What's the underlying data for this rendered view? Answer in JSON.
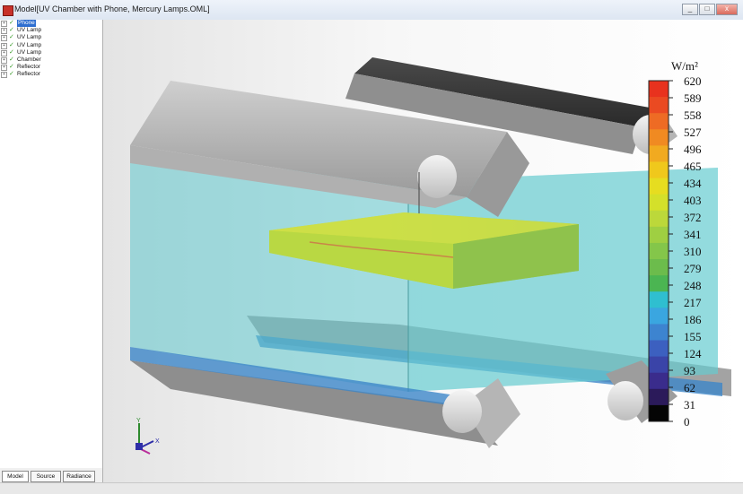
{
  "window": {
    "title": "Model[UV Chamber with Phone, Mercury Lamps.OML]",
    "controls": [
      "_",
      "□",
      "x"
    ]
  },
  "tree": {
    "items": [
      {
        "label": "Phone",
        "selected": true
      },
      {
        "label": "UV Lamp",
        "selected": false
      },
      {
        "label": "UV Lamp",
        "selected": false
      },
      {
        "label": "UV Lamp",
        "selected": false
      },
      {
        "label": "UV Lamp",
        "selected": false
      },
      {
        "label": "Chamber",
        "selected": false
      },
      {
        "label": "Reflector",
        "selected": false
      },
      {
        "label": "Reflector",
        "selected": false
      }
    ]
  },
  "tabs": [
    {
      "label": "Model",
      "active": true
    },
    {
      "label": "Source",
      "active": false
    },
    {
      "label": "Radiance",
      "active": false
    }
  ],
  "legend": {
    "unit": "W/m²",
    "ticks": [
      "620",
      "589",
      "558",
      "527",
      "496",
      "465",
      "434",
      "403",
      "372",
      "341",
      "310",
      "279",
      "248",
      "217",
      "186",
      "155",
      "124",
      "93",
      "62",
      "31",
      "0"
    ],
    "colors": [
      "#e8321e",
      "#ea4a22",
      "#ee6b24",
      "#f08a22",
      "#f1aa20",
      "#f0c81c",
      "#e6dd20",
      "#d4e02a",
      "#bcd83a",
      "#9fcf42",
      "#84c64a",
      "#6cbc4c",
      "#4bb552",
      "#2fbfd0",
      "#3aa6e0",
      "#3d84d0",
      "#3c60c0",
      "#3a44a8",
      "#3a2c8c",
      "#2b1a5a",
      "#050505"
    ],
    "range": [
      0,
      620
    ]
  },
  "axes": {
    "y_label": "Y",
    "x_label": "X"
  }
}
